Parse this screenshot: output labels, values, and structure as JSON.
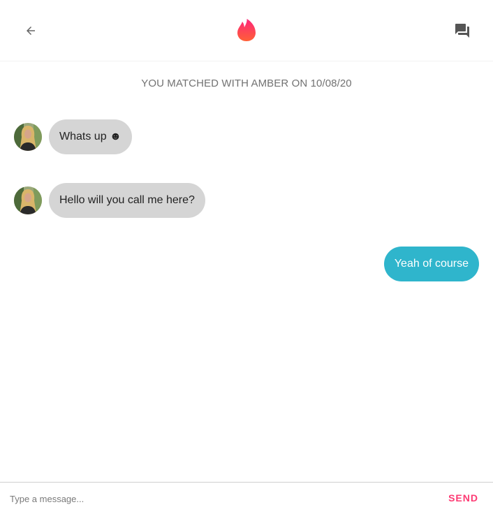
{
  "header": {
    "back_icon": "arrow-back-icon",
    "logo_icon": "flame-icon",
    "chats_icon": "forum-icon",
    "logo_gradient": [
      "#fd267a",
      "#ff6036"
    ]
  },
  "match_banner": "YOU MATCHED WITH AMBER ON 10/08/20",
  "messages": [
    {
      "from": "them",
      "text": "Whats up ☻",
      "avatar_icon": "profile-avatar"
    },
    {
      "from": "them",
      "text": "Hello will you call me here?",
      "avatar_icon": "profile-avatar"
    },
    {
      "from": "me",
      "text": "Yeah of course"
    }
  ],
  "composer": {
    "placeholder": "Type a message...",
    "value": "",
    "send_label": "SEND"
  },
  "colors": {
    "incoming_bubble": "#d5d5d5",
    "outgoing_bubble": "#2fb5cc",
    "send_accent": "#fd3a73",
    "banner_text": "#727272"
  }
}
